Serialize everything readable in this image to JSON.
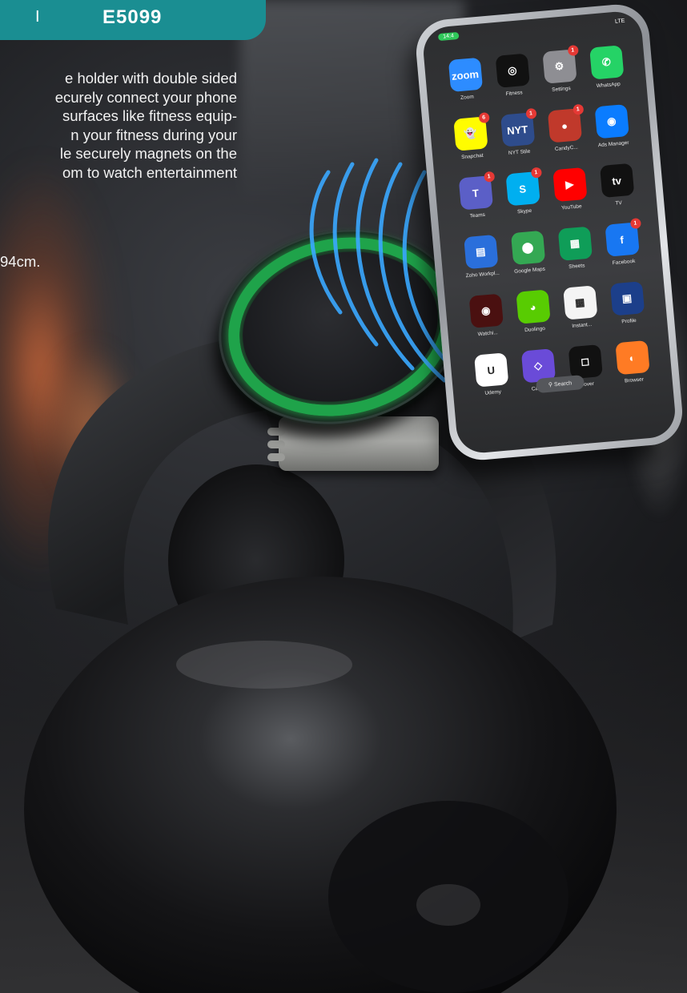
{
  "header": {
    "divider": "I",
    "code": "E5099",
    "color": "#1a8e92"
  },
  "description": {
    "line1": "e holder with double sided",
    "line2": "ecurely connect your phone",
    "line3": "surfaces like fitness equip-",
    "line4": "n your fitness during your",
    "line5": "le securely magnets on the",
    "line6": "om to watch entertainment",
    "dimensions": "94cm."
  },
  "phone": {
    "status_time": "14:4",
    "status_signal": "LTE",
    "search_label": "Search",
    "apps": [
      {
        "label": "Zoom",
        "glyph": "zoom",
        "color": "#2d8cff",
        "badge": ""
      },
      {
        "label": "Fitness",
        "glyph": "◎",
        "color": "#111111",
        "badge": ""
      },
      {
        "label": "Settings",
        "glyph": "⚙",
        "color": "#8e8e93",
        "badge": "1"
      },
      {
        "label": "WhatsApp",
        "glyph": "✆",
        "color": "#25d366",
        "badge": ""
      },
      {
        "label": "Snapchat",
        "glyph": "👻",
        "color": "#fffc00",
        "badge": "6"
      },
      {
        "label": "NYT Stile",
        "glyph": "NYT",
        "color": "#2e4c8c",
        "badge": "1"
      },
      {
        "label": "CandyC...",
        "glyph": "●",
        "color": "#c0392b",
        "badge": "1"
      },
      {
        "label": "Ads Manager",
        "glyph": "◉",
        "color": "#0a7cff",
        "badge": ""
      },
      {
        "label": "Teams",
        "glyph": "T",
        "color": "#5b5fc7",
        "badge": "1"
      },
      {
        "label": "Skype",
        "glyph": "S",
        "color": "#00aff0",
        "badge": "1"
      },
      {
        "label": "YouTube",
        "glyph": "▶",
        "color": "#ff0000",
        "badge": ""
      },
      {
        "label": "TV",
        "glyph": "tv",
        "color": "#111111",
        "badge": ""
      },
      {
        "label": "Zoho Workpl...",
        "glyph": "▤",
        "color": "#2a6fdb",
        "badge": ""
      },
      {
        "label": "Google Maps",
        "glyph": "⬤",
        "color": "#34a853",
        "badge": ""
      },
      {
        "label": "Sheets",
        "glyph": "▦",
        "color": "#0f9d58",
        "badge": ""
      },
      {
        "label": "Facebook",
        "glyph": "f",
        "color": "#1877f2",
        "badge": "1"
      },
      {
        "label": "Watchi...",
        "glyph": "◉",
        "color": "#4a1010",
        "badge": ""
      },
      {
        "label": "Duolingo",
        "glyph": "◕",
        "color": "#58cc02",
        "badge": ""
      },
      {
        "label": "Instant...",
        "glyph": "▦",
        "color": "#f4f4f4",
        "badge": ""
      },
      {
        "label": "Profile",
        "glyph": "▣",
        "color": "#1c3f8a",
        "badge": ""
      },
      {
        "label": "Udemy",
        "glyph": "U",
        "color": "#ffffff",
        "badge": ""
      },
      {
        "label": "Carbon",
        "glyph": "◇",
        "color": "#6a4bd8",
        "badge": ""
      },
      {
        "label": "Cover",
        "glyph": "◻",
        "color": "#111111",
        "badge": ""
      },
      {
        "label": "Browser",
        "glyph": "◐",
        "color": "#ff7b24",
        "badge": ""
      }
    ]
  },
  "colors": {
    "mount_ring": "#1fa34a",
    "waves": "#3aa8ff"
  }
}
